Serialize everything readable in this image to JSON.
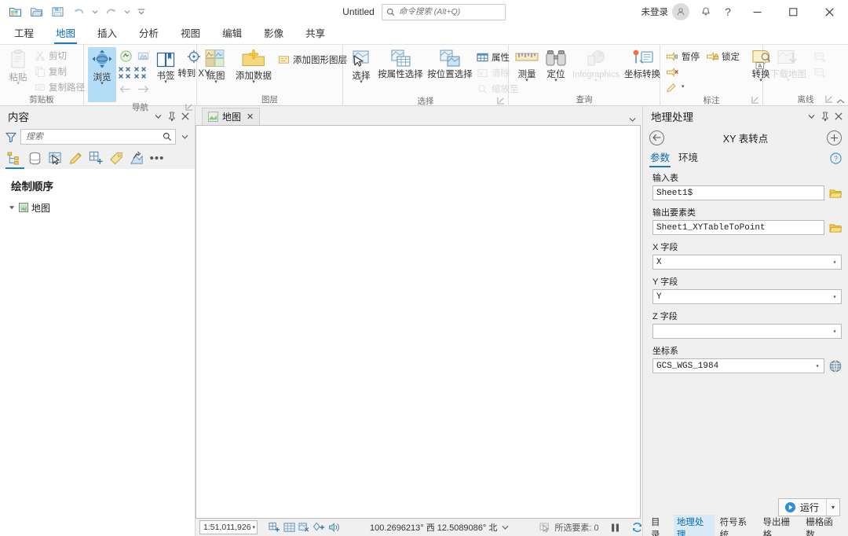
{
  "titlebar": {
    "doc_title": "Untitled",
    "qat": [
      {
        "name": "new-project-icon",
        "label": "新建工程"
      },
      {
        "name": "open-project-icon",
        "label": "打开工程"
      },
      {
        "name": "save-project-icon",
        "label": "保存工程"
      },
      {
        "name": "undo-icon",
        "label": "撤销"
      },
      {
        "name": "redo-icon",
        "label": "恢复"
      },
      {
        "name": "customize-qat-icon",
        "label": "自定义快速访问工具栏"
      }
    ],
    "search_placeholder": "命令搜索 (Alt+Q)",
    "signin_label": "未登录",
    "window_buttons": {
      "minimize": "─",
      "maximize": "□",
      "close": "✕"
    },
    "help_label": "?"
  },
  "ribbon": {
    "tabs": [
      {
        "label": "工程",
        "active": false
      },
      {
        "label": "地图",
        "active": true
      },
      {
        "label": "插入",
        "active": false
      },
      {
        "label": "分析",
        "active": false
      },
      {
        "label": "视图",
        "active": false
      },
      {
        "label": "编辑",
        "active": false
      },
      {
        "label": "影像",
        "active": false
      },
      {
        "label": "共享",
        "active": false
      }
    ],
    "groups": [
      {
        "name": "clipboard",
        "label": "剪贴板",
        "has_dialog_launcher": false,
        "big": [
          {
            "label": "粘贴",
            "caret": true,
            "disabled": true
          }
        ],
        "small": [
          {
            "label": "剪切",
            "disabled": true
          },
          {
            "label": "复制",
            "disabled": true
          },
          {
            "label": "复制路径",
            "disabled": true
          }
        ]
      },
      {
        "name": "navigate",
        "label": "导航",
        "has_dialog_launcher": true,
        "big": [
          {
            "label": "浏览",
            "caret": true,
            "selected": true
          },
          {
            "label": "书签",
            "caret": true
          },
          {
            "label": "转到 XY",
            "caret": false
          }
        ]
      },
      {
        "name": "layer",
        "label": "图层",
        "has_dialog_launcher": false,
        "big": [
          {
            "label": "底图",
            "caret": true
          },
          {
            "label": "添加数据",
            "caret": true
          }
        ],
        "small": [
          {
            "label": "添加图形图层",
            "disabled": false
          }
        ]
      },
      {
        "name": "selection",
        "label": "选择",
        "has_dialog_launcher": true,
        "big": [
          {
            "label": "选择",
            "caret": true
          },
          {
            "label": "按属性选择",
            "caret": false
          },
          {
            "label": "按位置选择",
            "caret": false
          }
        ],
        "small": [
          {
            "label": "属性",
            "disabled": false
          },
          {
            "label": "清除",
            "disabled": true
          },
          {
            "label": "缩放至",
            "disabled": true
          }
        ]
      },
      {
        "name": "inquiry",
        "label": "查询",
        "has_dialog_launcher": false,
        "big": [
          {
            "label": "测量",
            "caret": true
          },
          {
            "label": "定位",
            "caret": true
          },
          {
            "label": "Infographics",
            "caret": true,
            "disabled": true
          },
          {
            "label": "坐标转换",
            "caret": false
          }
        ]
      },
      {
        "name": "labeling",
        "label": "标注",
        "has_dialog_launcher": true,
        "big": [
          {
            "label": "转换",
            "caret": true
          }
        ],
        "small": [
          {
            "label": "暂停",
            "disabled": false
          },
          {
            "label": "锁定",
            "disabled": false
          },
          {
            "label": "",
            "disabled": false
          },
          {
            "label": "",
            "disabled": false
          }
        ]
      },
      {
        "name": "offline",
        "label": "离线",
        "has_dialog_launcher": true,
        "big": [
          {
            "label": "下载地图",
            "caret": true,
            "disabled": true
          }
        ],
        "small": [
          {
            "label": "",
            "disabled": true
          },
          {
            "label": "",
            "disabled": true
          }
        ]
      }
    ]
  },
  "contents": {
    "title": "内容",
    "search_placeholder": "搜索",
    "tools": [
      {
        "name": "list-by-drawing-order-icon",
        "active": true
      },
      {
        "name": "list-by-data-source-icon",
        "active": false
      },
      {
        "name": "list-by-selection-icon",
        "active": false
      },
      {
        "name": "list-by-editing-icon",
        "active": false
      },
      {
        "name": "list-by-snapping-icon",
        "active": false
      },
      {
        "name": "list-by-labeling-icon",
        "active": false
      },
      {
        "name": "list-by-diagram-icon",
        "active": false
      }
    ],
    "more_glyph": "•••",
    "section_heading": "绘制顺序",
    "tree": [
      {
        "label": "地图",
        "checked": true,
        "expanded": true
      }
    ]
  },
  "map": {
    "tabs": [
      {
        "label": "地图",
        "active": true
      }
    ],
    "close_glyph": "✕"
  },
  "statusbar": {
    "scale": "1:51,011,926",
    "coordinates": "100.2696213° 西 12.5089086° 北",
    "selected_features_label": "所选要素:",
    "selected_features_count": "0",
    "icons": [
      {
        "name": "add-bookmark-icon"
      },
      {
        "name": "grid-icon"
      },
      {
        "name": "measure-status-icon"
      },
      {
        "name": "add-point-icon"
      },
      {
        "name": "speaker-icon"
      }
    ],
    "pause_glyph": "▐▐",
    "refresh_name": "refresh-icon"
  },
  "geoprocessing": {
    "title": "地理处理",
    "tool_title": "XY 表转点",
    "back_glyph": "←",
    "add_glyph": "+",
    "tabs": [
      {
        "label": "参数",
        "active": true
      },
      {
        "label": "环境",
        "active": false
      }
    ],
    "help_glyph": "?",
    "fields": [
      {
        "label": "输入表",
        "value": "Sheet1$",
        "type": "text-browse"
      },
      {
        "label": "输出要素类",
        "value": "Sheet1_XYTableToPoint",
        "type": "text-browse"
      },
      {
        "label": "X 字段",
        "value": "X",
        "type": "dropdown"
      },
      {
        "label": "Y 字段",
        "value": "Y",
        "type": "dropdown"
      },
      {
        "label": "Z 字段",
        "value": "",
        "type": "dropdown"
      },
      {
        "label": "坐标系",
        "value": "GCS_WGS_1984",
        "type": "dropdown-globe"
      }
    ],
    "run_label": "运行",
    "bottom_tabs": [
      {
        "label": "目录",
        "active": false
      },
      {
        "label": "地理处理",
        "active": true
      },
      {
        "label": "符号系统",
        "active": false
      },
      {
        "label": "导出栅格",
        "active": false
      },
      {
        "label": "栅格函数",
        "active": false
      }
    ]
  },
  "colors": {
    "accent": "#1a7bc4",
    "ribbon_bg": "#fbfbfb",
    "panel_bg": "#f0f0f0",
    "selected_tool": "#b5dcf7"
  }
}
